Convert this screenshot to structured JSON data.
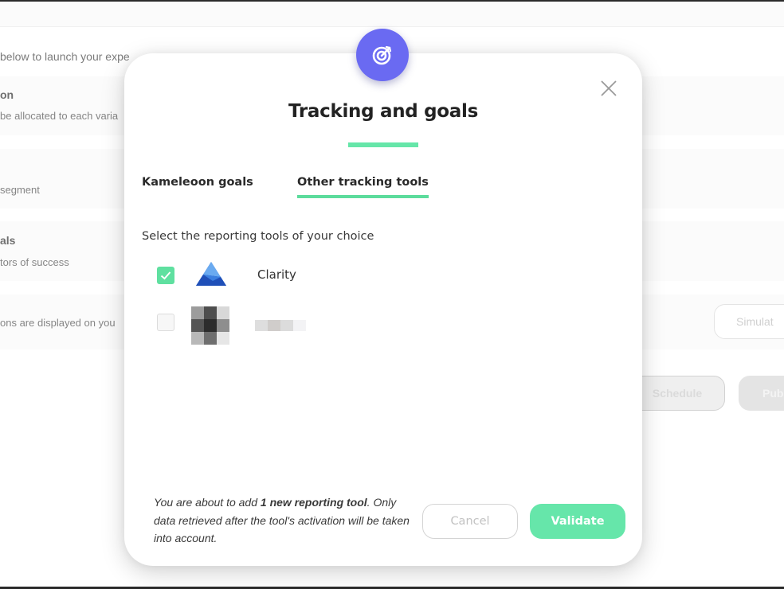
{
  "background": {
    "intro_text": "below to launch your expe",
    "cards": [
      {
        "title": "on",
        "subtitle": "be allocated to each varia"
      },
      {
        "title": "",
        "subtitle": "segment"
      },
      {
        "title": "als",
        "subtitle": "tors of success"
      },
      {
        "title": "",
        "subtitle": "ons are displayed on you"
      }
    ],
    "buttons": {
      "simulate": "Simulat",
      "schedule": "Schedule",
      "publish": "Pub"
    }
  },
  "modal": {
    "badge_icon": "target-icon",
    "close_icon": "close-icon",
    "title": "Tracking and goals",
    "accent_color": "#66e6a9",
    "tabs": [
      {
        "label": "Kameleoon goals",
        "active": false
      },
      {
        "label": "Other tracking tools",
        "active": true
      }
    ],
    "select_label": "Select the reporting tools of your choice",
    "tools": [
      {
        "name": "Clarity",
        "checked": true,
        "logo": "clarity-logo-icon"
      },
      {
        "name": "",
        "checked": false,
        "logo": "blurred-logo-icon",
        "redacted": true
      }
    ],
    "footer": {
      "note_prefix": "You are about to add ",
      "note_bold": "1 new reporting tool",
      "note_suffix": ". Only data retrieved after the tool's activation will be taken into account.",
      "cancel_label": "Cancel",
      "validate_label": "Validate"
    }
  }
}
